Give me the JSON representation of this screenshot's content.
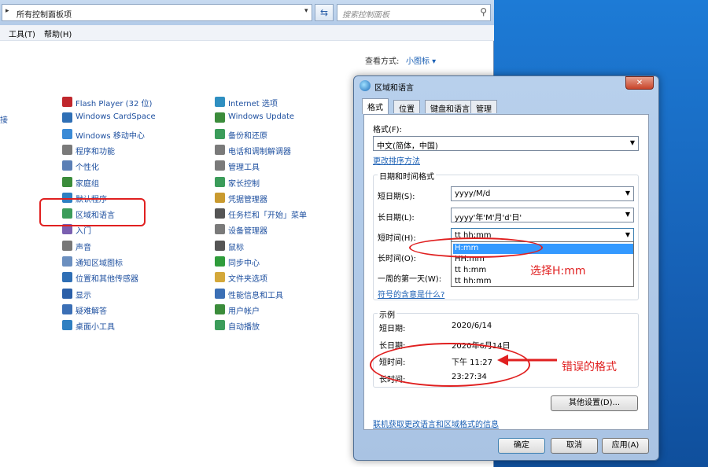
{
  "control_panel": {
    "address": "所有控制面板项",
    "search_placeholder": "搜索控制面板",
    "menu": [
      "工具(T)",
      "帮助(H)"
    ],
    "view_by_label": "查看方式:",
    "view_by_value": "小图标 ▾",
    "cut_text": "接",
    "column1": [
      "Flash Player (32 位)",
      "Windows CardSpace",
      "Windows 移动中心",
      "程序和功能",
      "个性化",
      "家庭组",
      "默认程序",
      "区域和语言",
      "入门",
      "声音",
      "通知区域图标",
      "位置和其他传感器",
      "显示",
      "疑难解答",
      "桌面小工具"
    ],
    "column2": [
      "Internet 选项",
      "Windows Update",
      "备份和还原",
      "电话和调制解调器",
      "管理工具",
      "家长控制",
      "凭据管理器",
      "任务栏和「开始」菜单",
      "设备管理器",
      "鼠标",
      "同步中心",
      "文件夹选项",
      "性能信息和工具",
      "用户帐户",
      "自动播放"
    ]
  },
  "dialog": {
    "title": "区域和语言",
    "tabs": [
      "格式",
      "位置",
      "键盘和语言",
      "管理"
    ],
    "format_label": "格式(F):",
    "format_value": "中文(简体，中国)",
    "sort_link": "更改排序方法",
    "datetime_group": "日期和时间格式",
    "short_date_label": "短日期(S):",
    "short_date_value": "yyyy/M/d",
    "long_date_label": "长日期(L):",
    "long_date_value": "yyyy'年'M'月'd'日'",
    "short_time_label": "短时间(H):",
    "short_time_value": "tt hh:mm",
    "long_time_label": "长时间(O):",
    "first_day_label": "一周的第一天(W):",
    "symbols_link": "符号的含意是什么?",
    "dropdown_options": [
      "H:mm",
      "HH:mm",
      "tt h:mm",
      "tt hh:mm"
    ],
    "examples_group": "示例",
    "examples": [
      {
        "label": "短日期:",
        "value": "2020/6/14"
      },
      {
        "label": "长日期:",
        "value": "2020年6月14日"
      },
      {
        "label": "短时间:",
        "value": "下午 11:27"
      },
      {
        "label": "长时间:",
        "value": "23:27:34"
      }
    ],
    "other_settings_button": "其他设置(D)...",
    "online_link": "联机获取更改语言和区域格式的信息",
    "ok_button": "确定",
    "cancel_button": "取消",
    "apply_button": "应用(A)"
  },
  "annotations": {
    "select_hint": "选择H:mm",
    "wrong_format": "错误的格式",
    "color": "#e02020"
  }
}
